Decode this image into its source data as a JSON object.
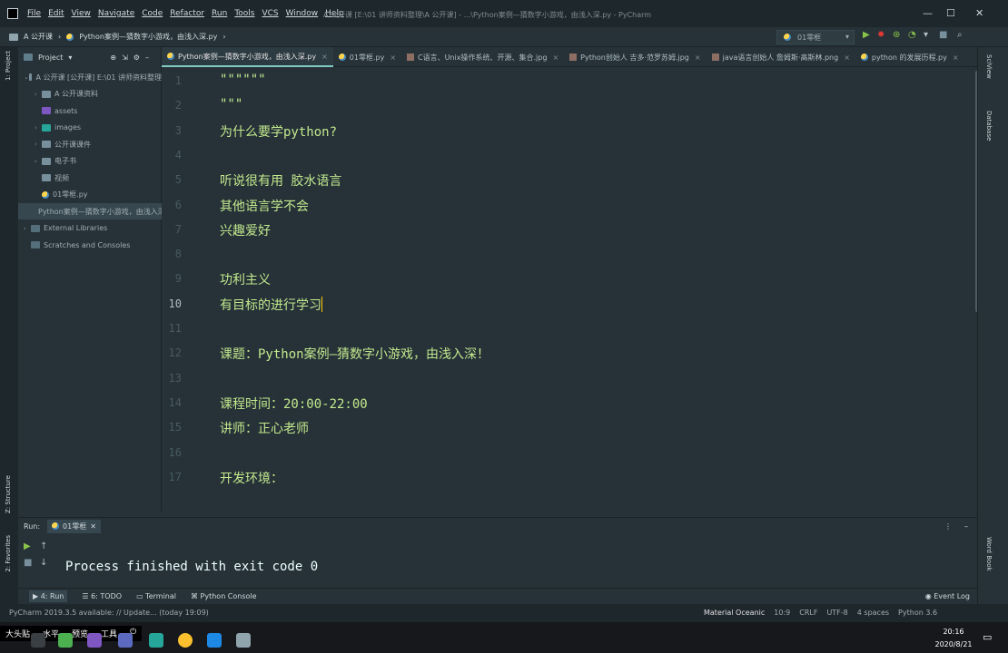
{
  "menu": [
    "File",
    "Edit",
    "View",
    "Navigate",
    "Code",
    "Refactor",
    "Run",
    "Tools",
    "VCS",
    "Window",
    "Help"
  ],
  "window_title": "A 公开课 [E:\\01 讲师资料整理\\A 公开课] - ...\\Python案例—猜数字小游戏，由浅入深.py - PyCharm",
  "breadcrumb": {
    "project": "A 公开课",
    "file": "Python案例—猜数字小游戏，由浅入深.py"
  },
  "run_config": {
    "label": "01零框"
  },
  "left_strip": {
    "project_label": "1: Project",
    "structure_label": "Z: Structure",
    "favorites_label": "2: Favorites"
  },
  "project_panel": {
    "title": "Project",
    "items": [
      {
        "label": "A 公开课 [公开课]  E:\\01 讲师资料整理",
        "indent": 0,
        "twisty": "v",
        "icon": "folder"
      },
      {
        "label": "A 公开课资料",
        "indent": 1,
        "twisty": ">",
        "icon": "folder"
      },
      {
        "label": "assets",
        "indent": 1,
        "twisty": "",
        "icon": "res"
      },
      {
        "label": "images",
        "indent": 1,
        "twisty": ">",
        "icon": "img"
      },
      {
        "label": "公开课课件",
        "indent": 1,
        "twisty": ">",
        "icon": "folder"
      },
      {
        "label": "电子书",
        "indent": 1,
        "twisty": ">",
        "icon": "folder"
      },
      {
        "label": "视频",
        "indent": 1,
        "twisty": "",
        "icon": "folder"
      },
      {
        "label": "01零框.py",
        "indent": 1,
        "twisty": "",
        "icon": "py"
      },
      {
        "label": "Python案例—猜数字小游戏，由浅入深.py",
        "indent": 1,
        "twisty": "",
        "icon": "py",
        "selected": true
      },
      {
        "label": "External Libraries",
        "indent": 0,
        "twisty": ">",
        "icon": "lib"
      },
      {
        "label": "Scratches and Consoles",
        "indent": 0,
        "twisty": "",
        "icon": "lib"
      }
    ]
  },
  "tabs": [
    {
      "label": "Python案例—猜数字小游戏，由浅入深.py",
      "icon": "py",
      "active": true
    },
    {
      "label": "01零框.py",
      "icon": "py"
    },
    {
      "label": "C语言、Unix操作系统、开源、集合.jpg",
      "icon": "img"
    },
    {
      "label": "Python创始人 吉多·范罗苏姆.jpg",
      "icon": "img"
    },
    {
      "label": "java语言创始人 詹姆斯·高斯林.png",
      "icon": "img"
    },
    {
      "label": "python 的发展历程.py",
      "icon": "py"
    }
  ],
  "editor": {
    "lines": [
      {
        "n": "1",
        "text": "\"\"\"\"\"\""
      },
      {
        "n": "2",
        "text": "\"\"\""
      },
      {
        "n": "3",
        "text": "为什么要学python?"
      },
      {
        "n": "4",
        "text": ""
      },
      {
        "n": "5",
        "text": "听说很有用 胶水语言"
      },
      {
        "n": "6",
        "text": "其他语言学不会"
      },
      {
        "n": "7",
        "text": "兴趣爱好"
      },
      {
        "n": "8",
        "text": ""
      },
      {
        "n": "9",
        "text": "功利主义"
      },
      {
        "n": "10",
        "text": "有目标的进行学习"
      },
      {
        "n": "11",
        "text": ""
      },
      {
        "n": "12",
        "text": "课题：Python案例—猜数字小游戏，由浅入深！"
      },
      {
        "n": "13",
        "text": ""
      },
      {
        "n": "14",
        "text": "课程时间：20:00-22:00"
      },
      {
        "n": "15",
        "text": "讲师：正心老师"
      },
      {
        "n": "16",
        "text": ""
      },
      {
        "n": "17",
        "text": "开发环境："
      }
    ],
    "current_line": 10
  },
  "right_strip": {
    "sciview_label": "SciView",
    "database_label": "Database",
    "word_book_label": "Word Book"
  },
  "run_panel": {
    "title": "Run:",
    "tab": "01零框",
    "output": "Process finished with exit code 0"
  },
  "tool_tabs": [
    "4: Run",
    "6: TODO",
    "Terminal",
    "Python Console"
  ],
  "event_log": "Event Log",
  "status": {
    "message": "PyCharm 2019.3.5 available: // Update... (today 19:09)",
    "theme": "Material Oceanic",
    "position": "10:9",
    "line_sep": "CRLF",
    "encoding": "UTF-8",
    "indent": "4 spaces",
    "interpreter": "Python 3.6"
  },
  "taskbar": {
    "floating": [
      "大头贴",
      "水平",
      "预览",
      "工具"
    ],
    "time": "20:16",
    "date": "2020/8/21"
  }
}
